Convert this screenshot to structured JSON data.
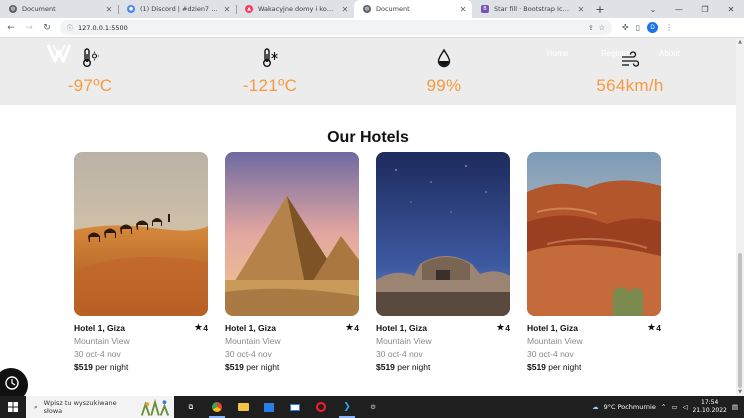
{
  "browser": {
    "tabs": [
      {
        "title": "Document",
        "favicon_color": "#5f6368",
        "active": false
      },
      {
        "title": "(1) Discord | #dzien7 | Serwer...",
        "favicon_color": "#4285f4",
        "active": false
      },
      {
        "title": "Wakacyjne domy i kondomini...",
        "favicon_color": "#ff385c",
        "active": false
      },
      {
        "title": "Document",
        "favicon_color": "#5f6368",
        "active": true
      },
      {
        "title": "Star fill · Bootstrap Icons",
        "favicon_color": "#7952b3",
        "active": false
      }
    ],
    "new_tab": "+",
    "window_controls": [
      "⌄",
      "—",
      "❐",
      "✕"
    ],
    "url": "127.0.0.1:5500",
    "profile_initial": "D"
  },
  "site": {
    "nav": [
      "Home",
      "Register",
      "About"
    ],
    "weather": [
      {
        "icon": "thermometer-sun-icon",
        "value": "-97ºC"
      },
      {
        "icon": "thermometer-snow-icon",
        "value": "-121ºC"
      },
      {
        "icon": "droplet-icon",
        "value": "99%"
      },
      {
        "icon": "wind-icon",
        "value": "564km/h"
      }
    ],
    "heading": "Our Hotels",
    "hotels": [
      {
        "name": "Hotel 1, Giza",
        "rating": "4",
        "view": "Mountain View",
        "dates": "30 oct-4 nov",
        "price": "$519",
        "per": " per night",
        "scene": "desert-camels"
      },
      {
        "name": "Hotel 1, Giza",
        "rating": "4",
        "view": "Mountain View",
        "dates": "30 oct-4 nov",
        "price": "$519",
        "per": " per night",
        "scene": "pyramids"
      },
      {
        "name": "Hotel 1, Giza",
        "rating": "4",
        "view": "Mountain View",
        "dates": "30 oct-4 nov",
        "price": "$519",
        "per": " per night",
        "scene": "night-ruins"
      },
      {
        "name": "Hotel 1, Giza",
        "rating": "4",
        "view": "Mountain View",
        "dates": "30 oct-4 nov",
        "price": "$519",
        "per": " per night",
        "scene": "red-rocks"
      }
    ],
    "accent_color": "#f79a3e"
  },
  "taskbar": {
    "search_placeholder": "Wpisz tu wyszukiwane słowa",
    "weather": "9°C  Pochmurnie",
    "time": "17:54",
    "date": "21.10.2022"
  }
}
